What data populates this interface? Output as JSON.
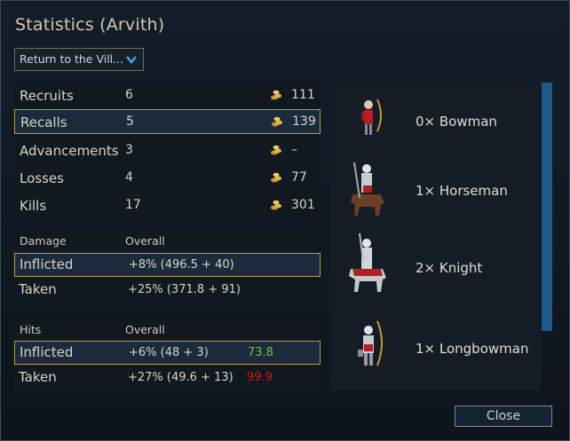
{
  "window": {
    "title": "Statistics (Arvith)"
  },
  "scenario_dropdown": {
    "selected": "Return to the Vill..."
  },
  "stats": [
    {
      "label": "Recruits",
      "count": "6",
      "gold": "111"
    },
    {
      "label": "Recalls",
      "count": "5",
      "gold": "139"
    },
    {
      "label": "Advancements",
      "count": "3",
      "gold": "–"
    },
    {
      "label": "Losses",
      "count": "4",
      "gold": "77"
    },
    {
      "label": "Kills",
      "count": "17",
      "gold": "301"
    }
  ],
  "damage": {
    "header": "Damage",
    "column": "Overall",
    "inflicted": {
      "label": "Inflicted",
      "value": "+8% (496.5 + 40)"
    },
    "taken": {
      "label": "Taken",
      "value": "+25% (371.8 + 91)"
    }
  },
  "hits": {
    "header": "Hits",
    "column": "Overall",
    "inflicted": {
      "label": "Inflicted",
      "value": "+6% (48 + 3)",
      "extra": "73.8"
    },
    "taken": {
      "label": "Taken",
      "value": "+27% (49.6 + 13)",
      "extra": "99.9"
    }
  },
  "units": [
    {
      "name": "0× Bowman",
      "icon": "bowman-sprite"
    },
    {
      "name": "1× Horseman",
      "icon": "horseman-sprite"
    },
    {
      "name": "2× Knight",
      "icon": "knight-sprite"
    },
    {
      "name": "1× Longbowman",
      "icon": "longbowman-sprite"
    }
  ],
  "buttons": {
    "close": "Close"
  },
  "colors": {
    "good": "#7fbf3f",
    "bad": "#d01616",
    "selection_border": "#b49a52",
    "accent": "#1d5a8a"
  }
}
